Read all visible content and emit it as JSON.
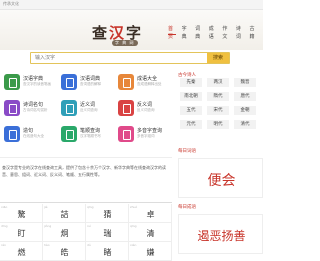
{
  "topbar": {
    "text": "传承文化"
  },
  "logo": {
    "title_a": "查",
    "title_b": "汉",
    "title_c": "字",
    "subtitle": "字 典 网"
  },
  "nav": [
    "首页",
    "字典",
    "词典",
    "成语",
    "作文",
    "诗词",
    "古籍"
  ],
  "search": {
    "placeholder": "输入汉字",
    "button": "搜索"
  },
  "tools": [
    {
      "title": "汉语字典",
      "desc": "查汉字的读音笔画",
      "color": "#3b9a4a"
    },
    {
      "title": "汉语词典",
      "desc": "查词语的解释",
      "color": "#3a6fd8"
    },
    {
      "title": "成语大全",
      "desc": "查成语解释出处",
      "color": "#e7873a"
    },
    {
      "title": "诗词名句",
      "desc": "古诗词名句赏析",
      "color": "#8a4bc7"
    },
    {
      "title": "近义词",
      "desc": "近义词查询",
      "color": "#2f9fb8"
    },
    {
      "title": "反义词",
      "desc": "反义词查询",
      "color": "#d94343"
    },
    {
      "title": "造句",
      "desc": "在线造句大全",
      "color": "#3b6fd8"
    },
    {
      "title": "笔顺查询",
      "desc": "汉字笔顺书写",
      "color": "#2aa86a"
    },
    {
      "title": "多音字查询",
      "desc": "多音字组词",
      "color": "#e04a8a"
    }
  ],
  "intro": "查汉字是专业的汉字在线查询工具，提供了包含十余万个汉字、新华字典等在线查询汉字的读音、意思、组词、近义词、反义词、笔顺、五行属性等。",
  "chars": [
    {
      "py": "xiāo",
      "zi": "驁"
    },
    {
      "py": "jié",
      "zi": "詰"
    },
    {
      "py": "qīng",
      "zi": "猜"
    },
    {
      "py": "zhuó",
      "zi": "卓"
    },
    {
      "py": "dīng",
      "zi": "盯"
    },
    {
      "py": "jiǒng",
      "zi": "炯"
    },
    {
      "py": "ruì",
      "zi": "瑞"
    },
    {
      "py": "qīng",
      "zi": "清"
    },
    {
      "py": "rán",
      "zi": "燃"
    },
    {
      "py": "hào",
      "zi": "皓"
    },
    {
      "py": "dǔ",
      "zi": "睹"
    },
    {
      "py": "xián",
      "zi": "嫌"
    }
  ],
  "sidebar": {
    "era_title": "古今诗人",
    "eras": [
      "先秦",
      "两汉",
      "魏晋",
      "南北朝",
      "隋代",
      "唐代",
      "五代",
      "宋代",
      "金朝",
      "元代",
      "明代",
      "清代"
    ],
    "daily_word_title": "每日词语",
    "daily_word": "便会",
    "daily_idiom_title": "每日成语",
    "daily_idiom": "遏恶扬善"
  },
  "colors": {
    "accent": "#c8352b",
    "search_button": "#f0c040"
  }
}
